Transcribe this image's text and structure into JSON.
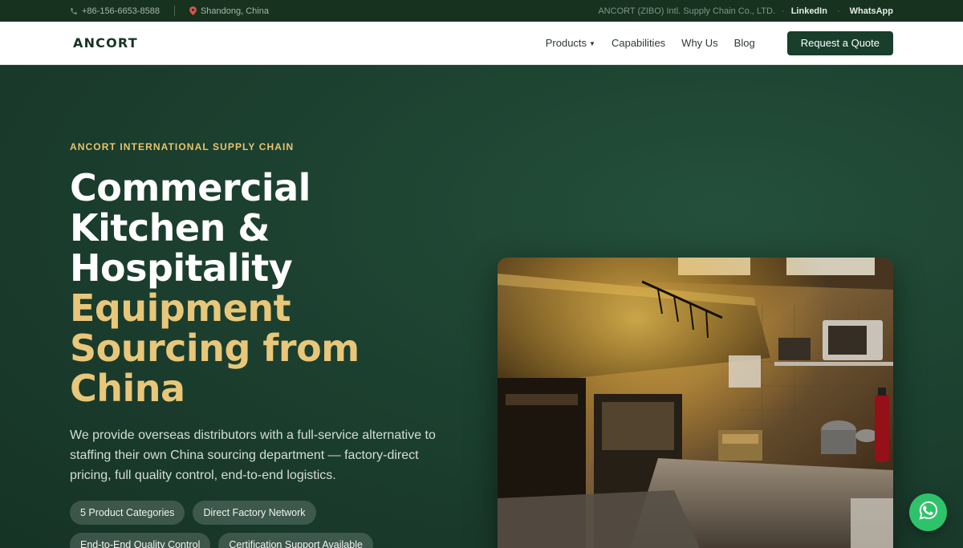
{
  "topbar": {
    "phone": "+86-156-6653-8588",
    "location": "Shandong, China",
    "company": "ANCORT (ZIBO) Intl. Supply Chain Co., LTD.",
    "linkedin": "LinkedIn",
    "whatsapp": "WhatsApp"
  },
  "nav": {
    "logo": "ANCORT",
    "items": [
      "Products",
      "Capabilities",
      "Why Us",
      "Blog"
    ],
    "cta": "Request a Quote"
  },
  "hero": {
    "eyebrow": "ANCORT INTERNATIONAL SUPPLY CHAIN",
    "headline_white": [
      "Commercial",
      "Kitchen &",
      "Hospitality"
    ],
    "headline_gold": [
      "Equipment",
      "Sourcing from",
      "China"
    ],
    "lead": "We provide overseas distributors with a full-service alternative to staffing their own China sourcing department — factory-direct pricing, full quality control, end-to-end logistics.",
    "pills": [
      "5 Product Categories",
      "Direct Factory Network",
      "End-to-End Quality Control",
      "Certification Support Available"
    ]
  },
  "colors": {
    "accent_gold": "#e8c77a",
    "brand_green": "#183f2c",
    "whatsapp_green": "#2ec36a"
  },
  "icons": [
    "phone-icon",
    "map-pin-icon",
    "whatsapp-icon"
  ]
}
